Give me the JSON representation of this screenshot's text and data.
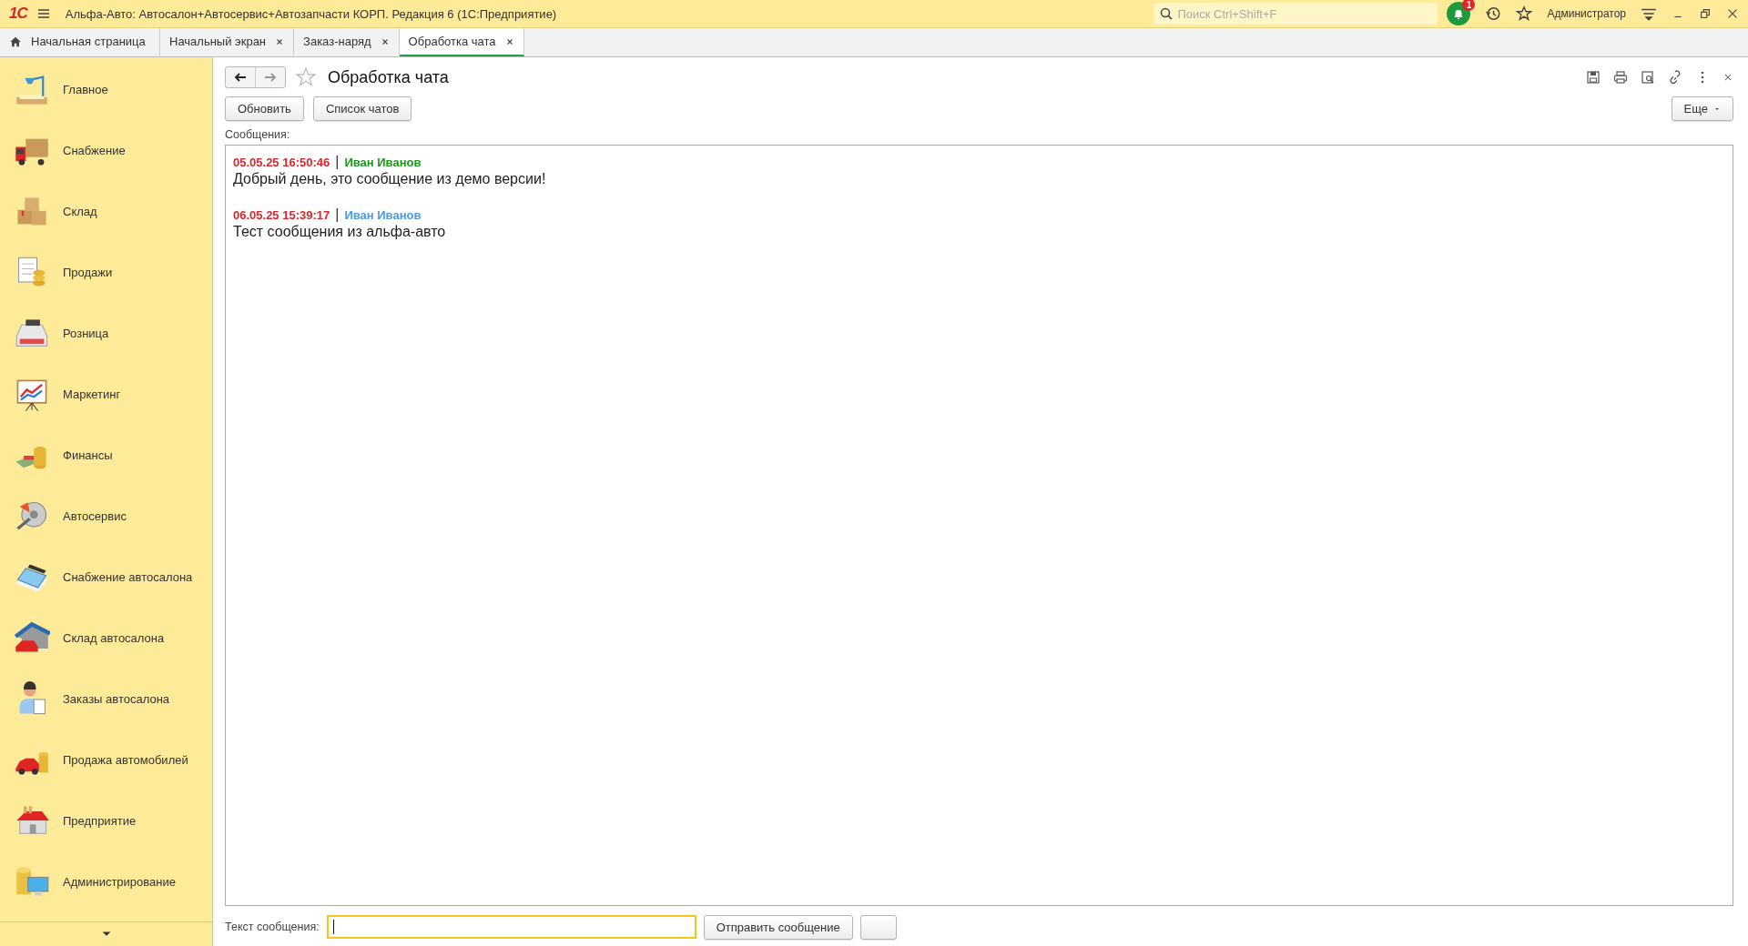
{
  "title_bar": {
    "logo": "1С",
    "title": "Альфа-Авто: Автосалон+Автосервис+Автозапчасти КОРП. Редакция 6  (1С:Предприятие)",
    "search": {
      "placeholder": "Поиск Ctrl+Shift+F"
    },
    "notification_count": "1",
    "user": "Администратор"
  },
  "tabs": [
    {
      "label": "Начальная страница",
      "kind": "home",
      "selected": false
    },
    {
      "label": "Начальный экран",
      "kind": "closable",
      "selected": false
    },
    {
      "label": "Заказ-наряд",
      "kind": "closable",
      "selected": false
    },
    {
      "label": "Обработка чата",
      "kind": "closable",
      "selected": true
    }
  ],
  "sidebar": {
    "items": [
      {
        "label": "Главное"
      },
      {
        "label": "Снабжение"
      },
      {
        "label": "Склад"
      },
      {
        "label": "Продажи"
      },
      {
        "label": "Розница"
      },
      {
        "label": "Маркетинг"
      },
      {
        "label": "Финансы"
      },
      {
        "label": "Автосервис"
      },
      {
        "label": "Снабжение автосалона"
      },
      {
        "label": "Склад автосалона"
      },
      {
        "label": "Заказы автосалона"
      },
      {
        "label": "Продажа автомобилей"
      },
      {
        "label": "Предприятие"
      },
      {
        "label": "Администрирование"
      }
    ]
  },
  "form": {
    "title": "Обработка чата",
    "favorite": false,
    "buttons": [
      "Обновить",
      "Список чатов"
    ],
    "more_button": "Еще",
    "messages_label": "Сообщения:",
    "messages": [
      {
        "time": "05.05.25 16:50:46",
        "separator": "|",
        "author": "Иван Иванов",
        "color": "#1a9a1a",
        "text": "Добрый день, это сообщение из демо версии!"
      },
      {
        "time": "06.05.25 15:39:17",
        "separator": "|",
        "author": "Иван Иванов",
        "color": "#4a9ae8",
        "text": "Тест сообщения из альфа-авто"
      }
    ],
    "input_label": "Текст сообщения:",
    "input": {
      "focused": true
    },
    "send_button": "Отправить сообщение"
  }
}
